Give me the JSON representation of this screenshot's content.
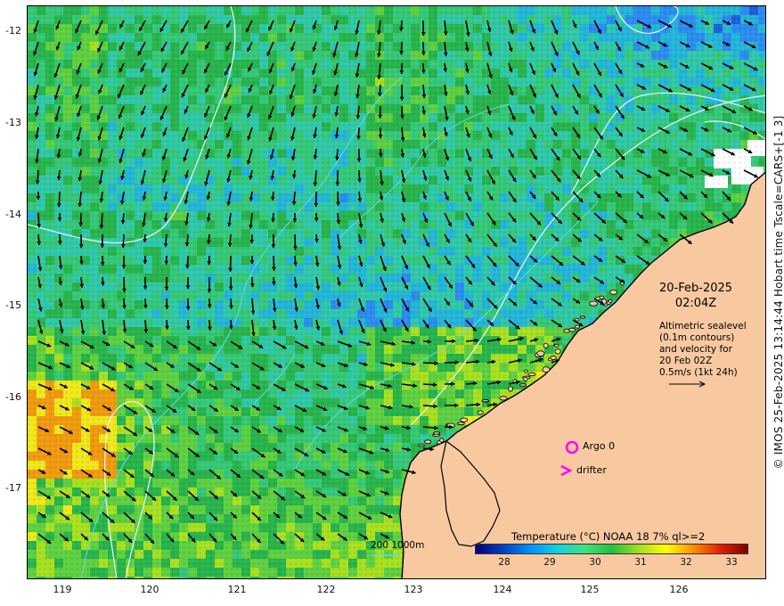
{
  "map": {
    "lat_labels": [
      "-12",
      "-13",
      "-14",
      "-15",
      "-16",
      "-17"
    ],
    "lon_labels": [
      "119",
      "120",
      "121",
      "122",
      "123",
      "124",
      "125",
      "126"
    ],
    "lat_range": [
      -17.9,
      -11.7
    ],
    "lon_range": [
      118.6,
      126.9
    ],
    "colors": {
      "land": "#f8c9a0",
      "coast": "#000000",
      "contour": "#e9f4ff",
      "bathymetry_contour": "#5fd6e6",
      "arrow": "#000000",
      "argo": "#ff00ff",
      "drifter": "#ff00ff"
    }
  },
  "annotations": {
    "date": "20-Feb-2025",
    "time": "02:04Z",
    "altimetry_text": [
      "Altimetric sealevel",
      "(0.1m contours)",
      "and velocity for",
      "20 Feb 02Z",
      "0.5m/s (1kt 24h)"
    ],
    "argo_label": "Argo 0",
    "drifter_label": "drifter",
    "contour_legend": "200  1000m"
  },
  "colorbar": {
    "title": "Temperature (°C) NOAA 18 7% ql>=2",
    "ticks": [
      "28",
      "29",
      "30",
      "31",
      "32",
      "33"
    ],
    "range": [
      27.4,
      33.6
    ],
    "colors": [
      "#00007f",
      "#0040c0",
      "#0090ff",
      "#10d0e0",
      "#40e080",
      "#20c040",
      "#a0e020",
      "#ffff00",
      "#ff9000",
      "#e02000",
      "#7f0000"
    ]
  },
  "credit": "© IMOS 25-Feb-2025 13:14:44 Hobart time Tscale=CARS+[-1 3]"
}
